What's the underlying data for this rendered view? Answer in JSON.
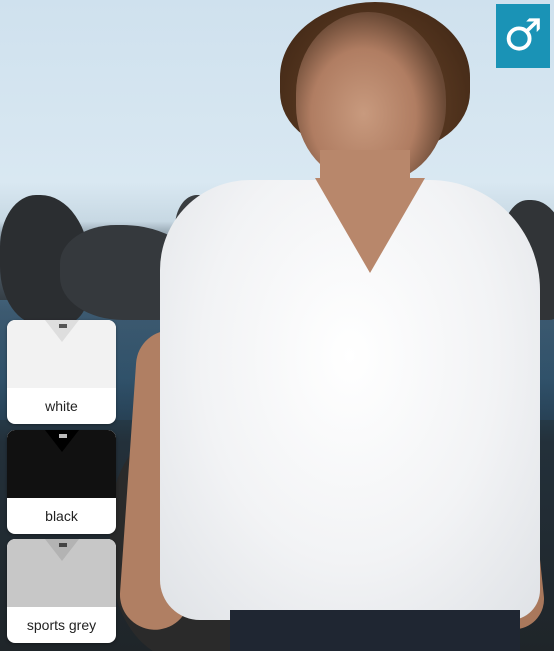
{
  "gender": {
    "symbol": "♂",
    "color": "#1a93b6"
  },
  "swatches": [
    {
      "label": "white",
      "color": "#f4f4f4"
    },
    {
      "label": "black",
      "color": "#111111"
    },
    {
      "label": "sports grey",
      "color": "#c9c9c9"
    }
  ]
}
